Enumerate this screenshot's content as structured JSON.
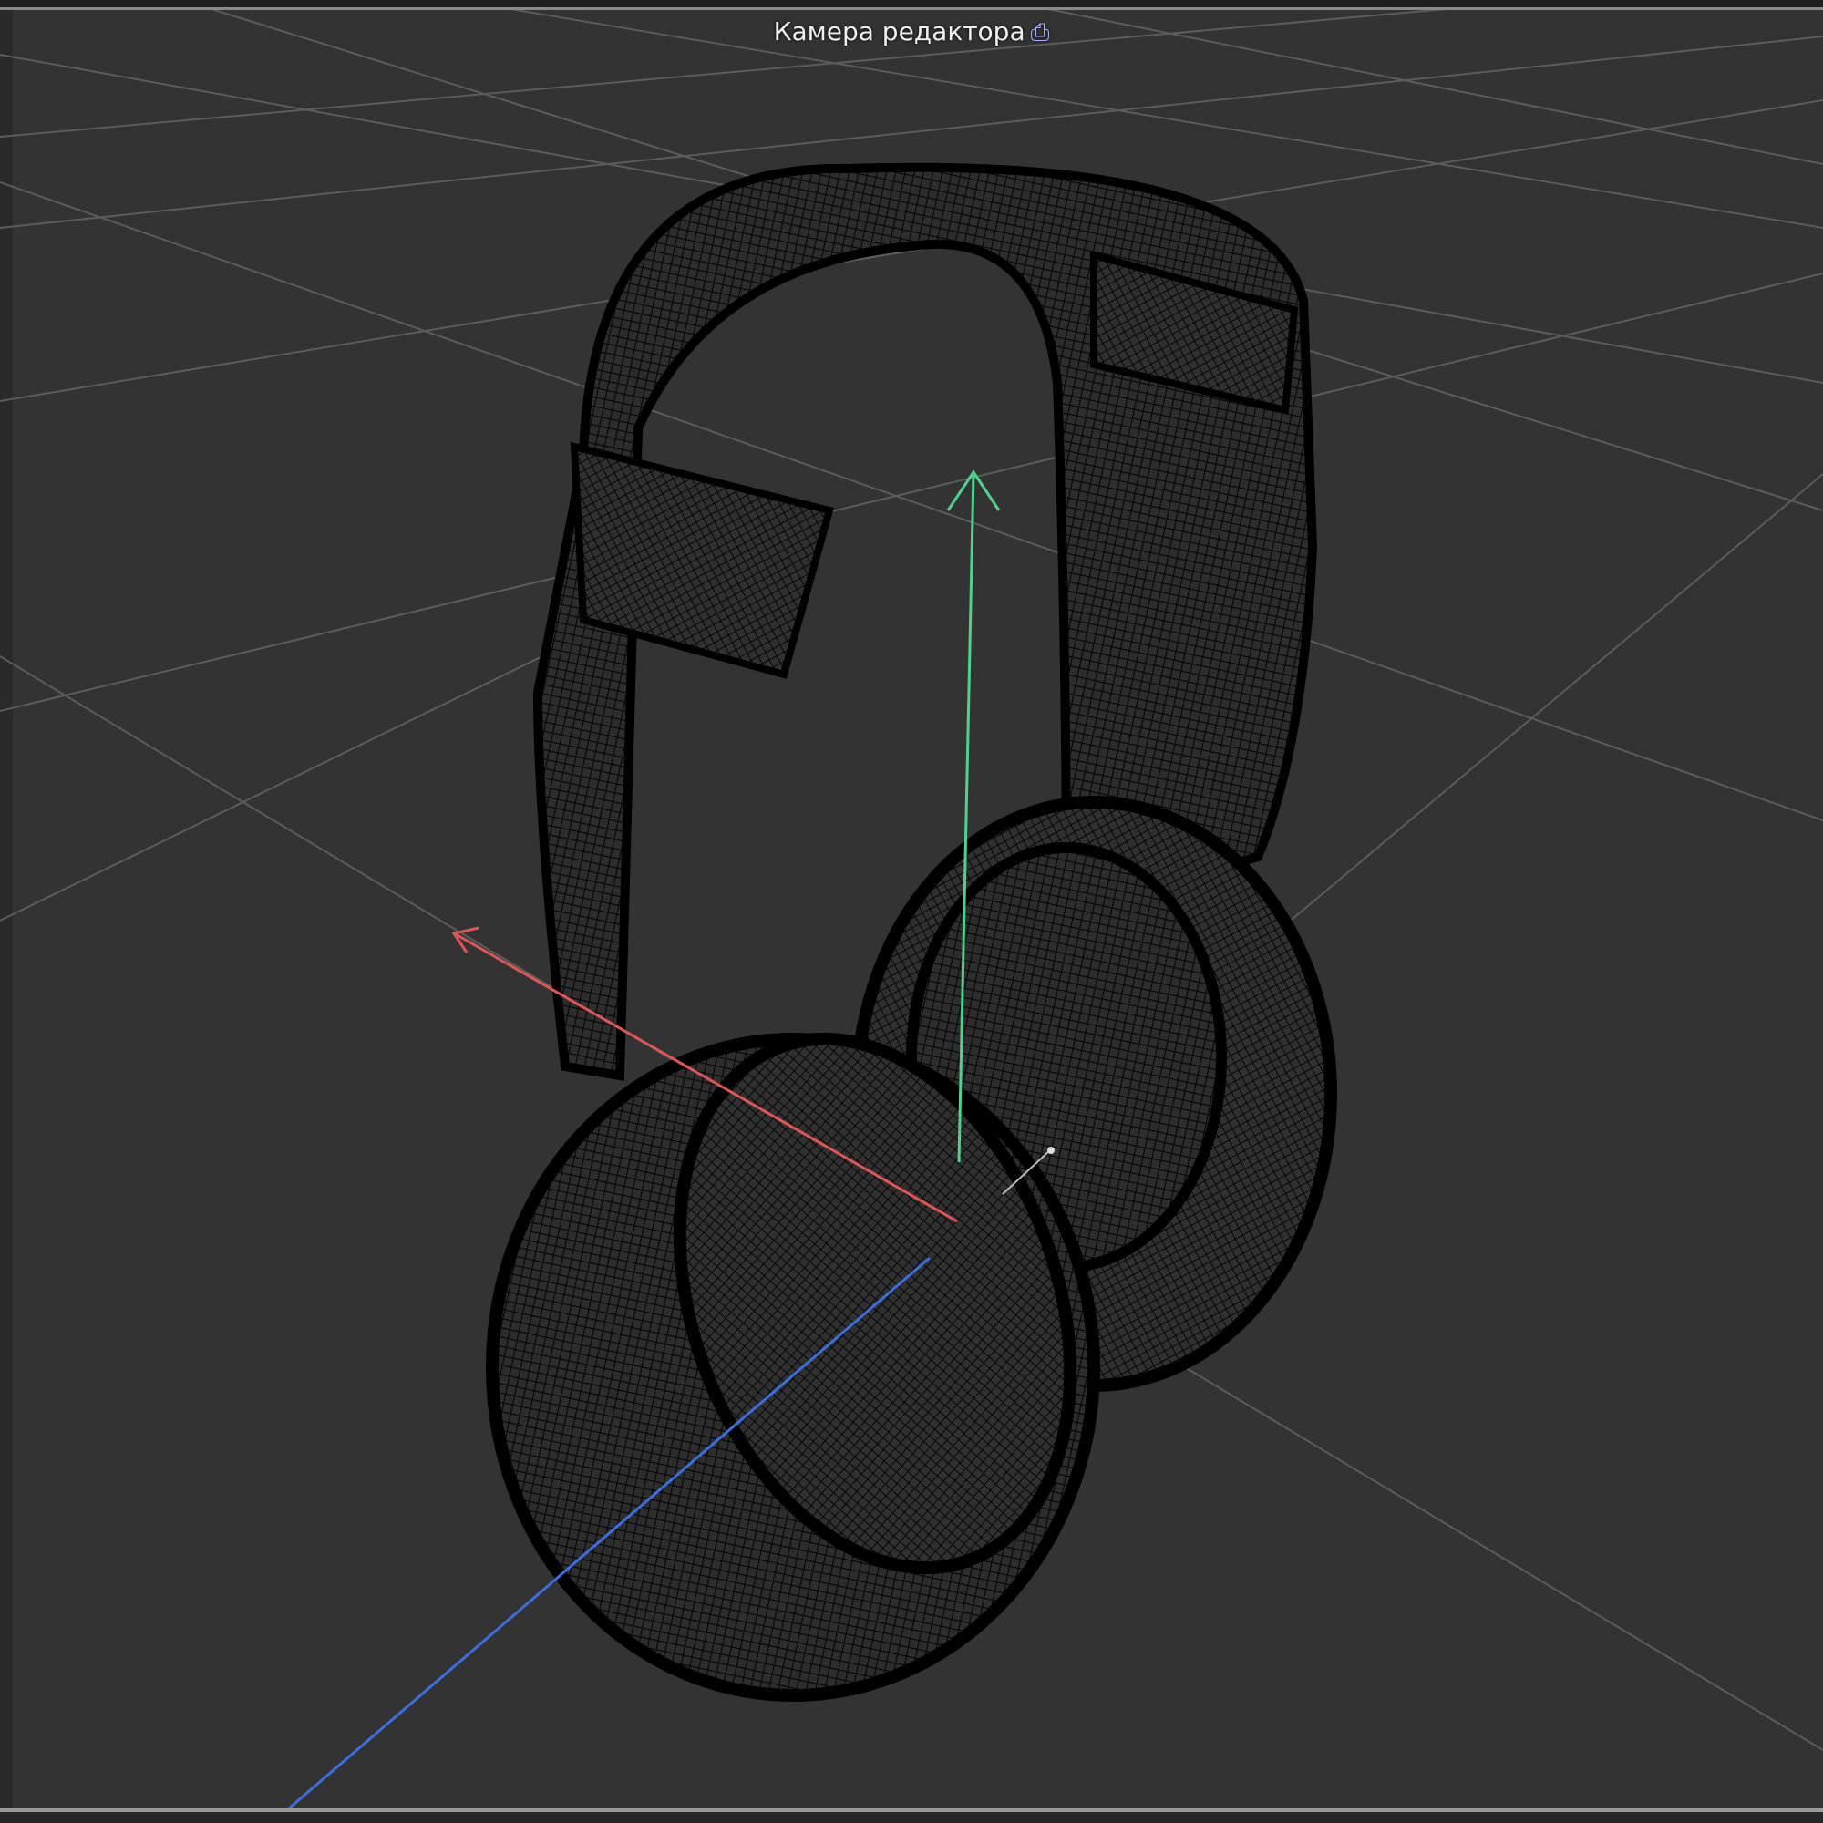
{
  "viewport": {
    "camera_label": "Камера редактора",
    "camera_icon": "camera-icon",
    "axis_colors": {
      "x": "#e05555",
      "y": "#4fd38a",
      "z": "#3a6fe0"
    },
    "background": "#333333"
  }
}
